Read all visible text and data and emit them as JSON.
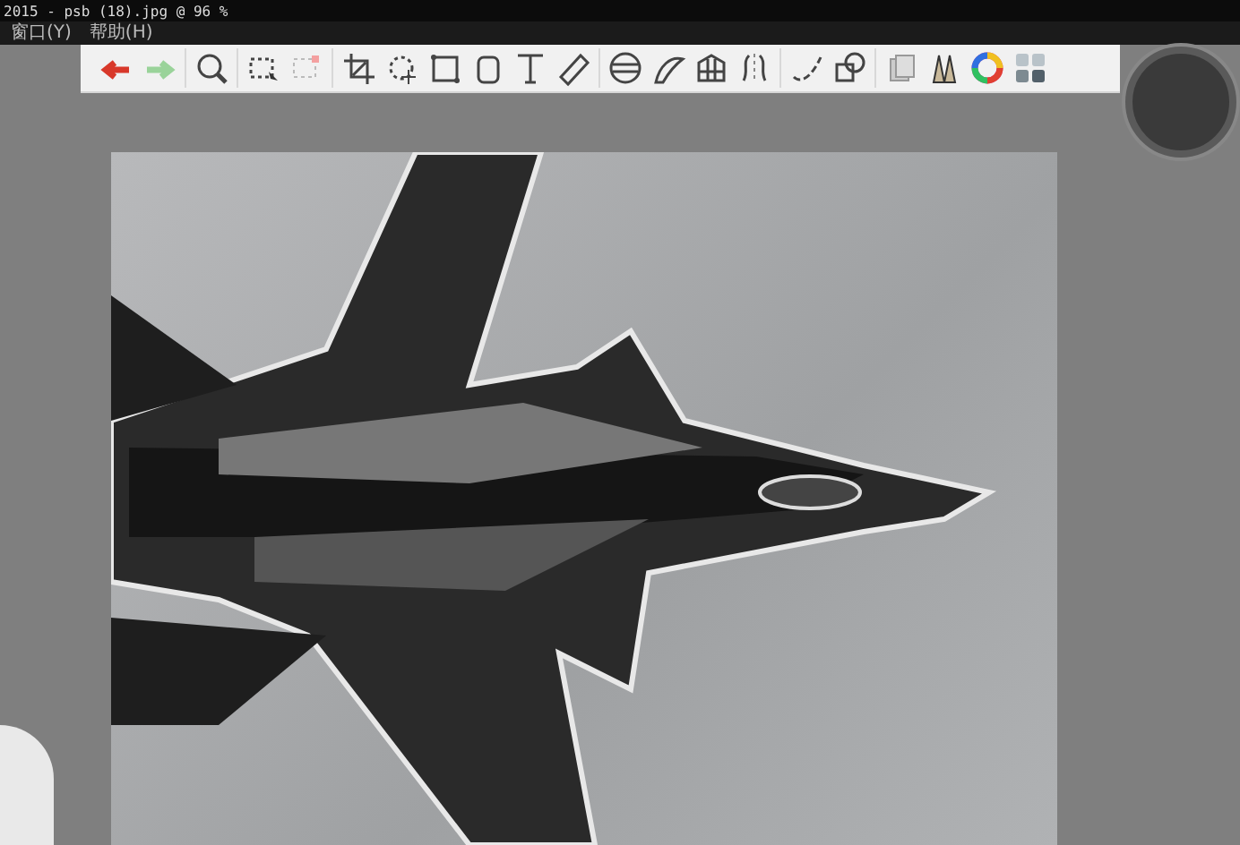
{
  "window": {
    "title": "2015 - psb (18).jpg @ 96 %"
  },
  "menu": [
    {
      "label": "窗口(Y)"
    },
    {
      "label": "帮助(H)"
    }
  ]
}
